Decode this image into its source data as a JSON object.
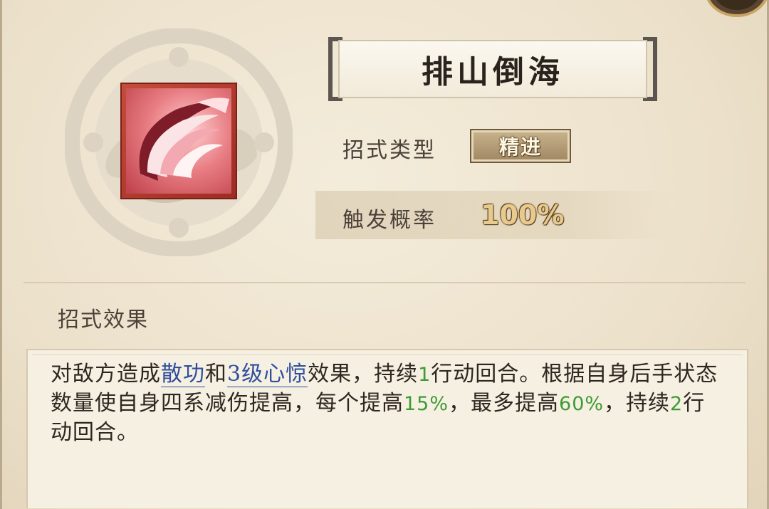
{
  "skill": {
    "name": "排山倒海",
    "type_label": "招式类型",
    "type_value": "精进",
    "prob_label": "触发概率",
    "prob_value": "100%"
  },
  "effect": {
    "section_label": "招式效果",
    "segments": [
      {
        "text": "对敌方造成",
        "style": "plain"
      },
      {
        "text": "散功",
        "style": "keyword"
      },
      {
        "text": "和",
        "style": "plain"
      },
      {
        "text": "3级心惊",
        "style": "keyword"
      },
      {
        "text": "效果，持续",
        "style": "plain"
      },
      {
        "text": "1",
        "style": "number"
      },
      {
        "text": "行动回合。根据自身后手状态数量使自身四系减伤提高，每个提高",
        "style": "plain"
      },
      {
        "text": "15%",
        "style": "number"
      },
      {
        "text": "，最多提高",
        "style": "plain"
      },
      {
        "text": "60%",
        "style": "number"
      },
      {
        "text": "，持续",
        "style": "plain"
      },
      {
        "text": "2",
        "style": "number"
      },
      {
        "text": "行动回合。",
        "style": "plain"
      }
    ]
  },
  "icons": {
    "skill_icon": "crimson-slash-icon",
    "emblem": "cloud-emblem-icon",
    "corner": "play-button-icon"
  },
  "colors": {
    "keyword": "#2e4f9c",
    "number": "#3d9b33",
    "gold": "#e8c98e"
  }
}
